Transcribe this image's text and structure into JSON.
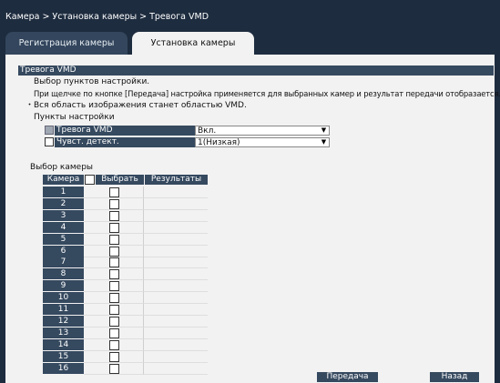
{
  "breadcrumb": "Камера > Установка камеры > Тревога VMD",
  "tabs": [
    {
      "label": "Регистрация камеры"
    },
    {
      "label": "Установка камеры"
    }
  ],
  "section_title": "Тревога VMD",
  "info": {
    "line1": "Выбор пунктов настройки.",
    "line2": "При щелчке по кнопке [Передача] настройка применяется для выбранных камер и результат передачи отобразается.",
    "line3": "・Вся область изображения станет областью VMD."
  },
  "settings": {
    "title": "Пункты настройки",
    "rows": [
      {
        "label": "Тревога VMD",
        "value": "Вкл.",
        "checked": true
      },
      {
        "label": "Чувст. детект.",
        "value": "1(Низкая)",
        "checked": false
      }
    ]
  },
  "camera_select": {
    "title": "Выбор камеры",
    "headers": {
      "camera": "Камера",
      "select": "Выбрать",
      "results": "Результаты"
    },
    "cameras": [
      "1",
      "2",
      "3",
      "4",
      "5",
      "6",
      "7",
      "8",
      "9",
      "10",
      "11",
      "12",
      "13",
      "14",
      "15",
      "16"
    ]
  },
  "buttons": {
    "transfer": "Передача",
    "back": "Назад"
  },
  "colors": {
    "background": "#1e2c3f",
    "panel": "#f2f2f2",
    "header": "#35495f"
  }
}
